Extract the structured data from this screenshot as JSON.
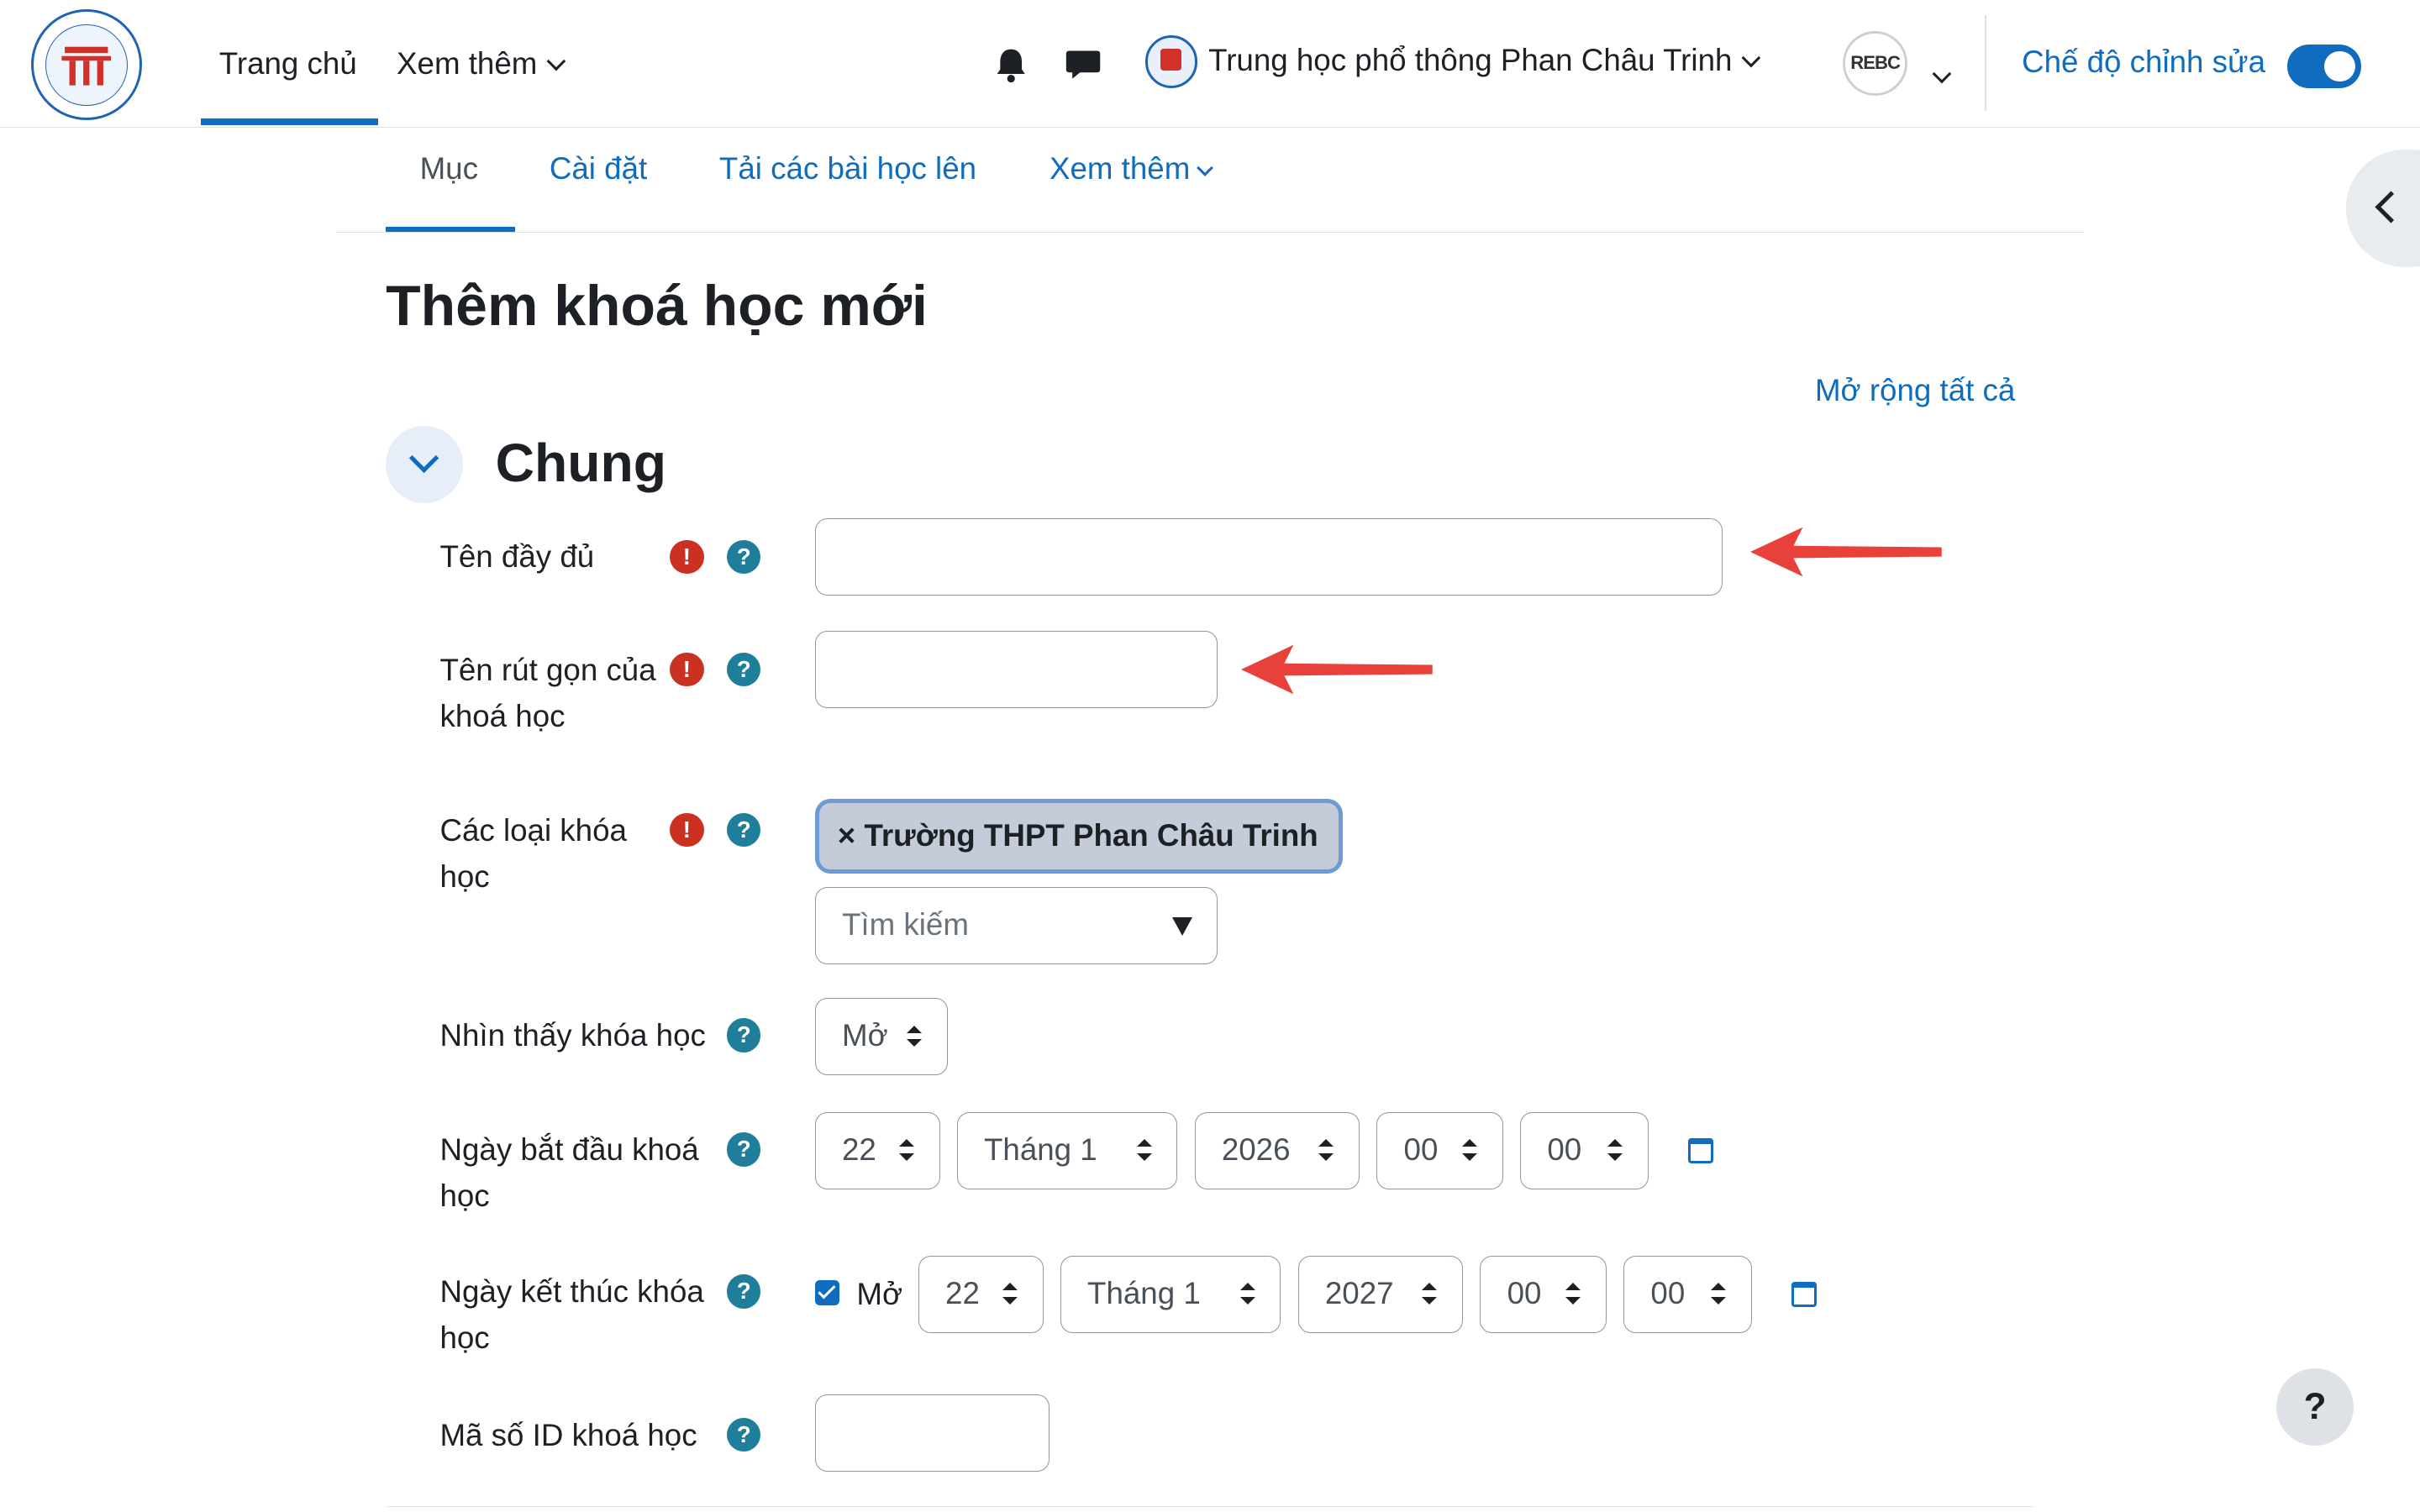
{
  "navbar": {
    "home": "Trang chủ",
    "more": "Xem thêm",
    "school_name": "Trung học phổ thông Phan Châu Trinh",
    "avatar_text": "REBC",
    "edit_mode_label": "Chế độ chỉnh sửa",
    "edit_mode_on": true
  },
  "subnav": {
    "items": [
      "Mục",
      "Cài đặt",
      "Tải các bài học lên",
      "Xem thêm"
    ],
    "active": "Mục"
  },
  "page": {
    "title": "Thêm khoá học mới",
    "expand_all": "Mở rộng tất cả",
    "section_title": "Chung"
  },
  "form": {
    "fullname_label": "Tên đầy đủ",
    "shortname_label_1": "Tên rút gọn của",
    "shortname_label_2": "khoá học",
    "category_label_1": "Các loại khóa",
    "category_label_2": "học",
    "category_chip": "× Trường THPT Phan Châu Trinh",
    "category_search_placeholder": "Tìm kiếm",
    "visibility_label": "Nhìn thấy khóa học",
    "visibility_value": "Mở",
    "start_label_1": "Ngày bắt đầu khoá",
    "start_label_2": "học",
    "start_day": "22",
    "start_month": "Tháng 1",
    "start_year": "2026",
    "start_hour": "00",
    "start_minute": "00",
    "end_label_1": "Ngày kết thúc khóa",
    "end_label_2": "học",
    "end_enabled_label": "Mở",
    "end_day": "22",
    "end_month": "Tháng 1",
    "end_year": "2027",
    "end_hour": "00",
    "end_minute": "00",
    "idnumber_label": "Mã số ID khoá học"
  },
  "icons": {
    "required": "!",
    "help": "?",
    "help_fab": "?"
  },
  "colors": {
    "primary": "#0f6cbf",
    "required": "#ca3120",
    "help": "#1f7e9a",
    "annotation_arrow": "#e8413c"
  }
}
